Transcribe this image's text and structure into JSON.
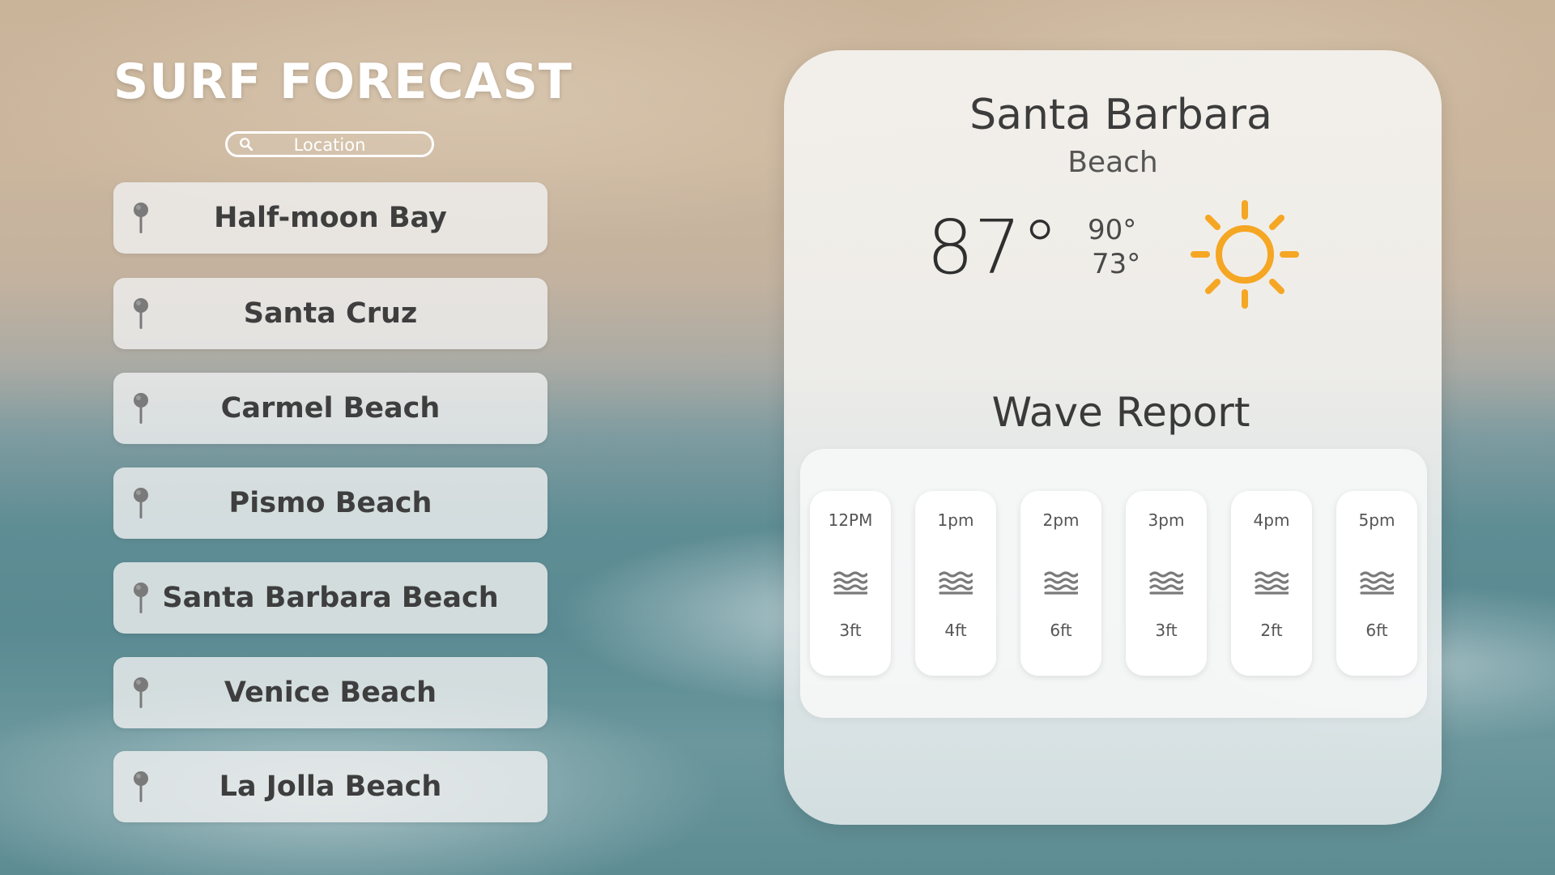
{
  "app": {
    "title": "SURF FORECAST"
  },
  "search": {
    "placeholder": "Location",
    "icon": "search-icon"
  },
  "locations": [
    {
      "label": "Half-moon Bay",
      "icon": "map-pin-icon"
    },
    {
      "label": "Santa Cruz",
      "icon": "map-pin-icon"
    },
    {
      "label": "Carmel Beach",
      "icon": "map-pin-icon"
    },
    {
      "label": "Pismo Beach",
      "icon": "map-pin-icon"
    },
    {
      "label": "Santa Barbara Beach",
      "icon": "map-pin-icon"
    },
    {
      "label": "Venice Beach",
      "icon": "map-pin-icon"
    },
    {
      "label": "La Jolla Beach",
      "icon": "map-pin-icon"
    }
  ],
  "forecast": {
    "city": "Santa Barbara",
    "city_suffix": "Beach",
    "current_temp": "87°",
    "high_temp": "90°",
    "low_temp": "73°",
    "condition_icon": "sun-icon",
    "wave_report_title": "Wave Report",
    "hours": [
      {
        "time": "12PM",
        "height": "3ft",
        "icon": "waves-icon"
      },
      {
        "time": "1pm",
        "height": "4ft",
        "icon": "waves-icon"
      },
      {
        "time": "2pm",
        "height": "6ft",
        "icon": "waves-icon"
      },
      {
        "time": "3pm",
        "height": "3ft",
        "icon": "waves-icon"
      },
      {
        "time": "4pm",
        "height": "2ft",
        "icon": "waves-icon"
      },
      {
        "time": "5pm",
        "height": "6ft",
        "icon": "waves-icon"
      }
    ]
  },
  "colors": {
    "sun": "#f5a623",
    "pin": "#7a7a7a",
    "title": "#ffffff",
    "card_text": "#3e3e3e"
  }
}
